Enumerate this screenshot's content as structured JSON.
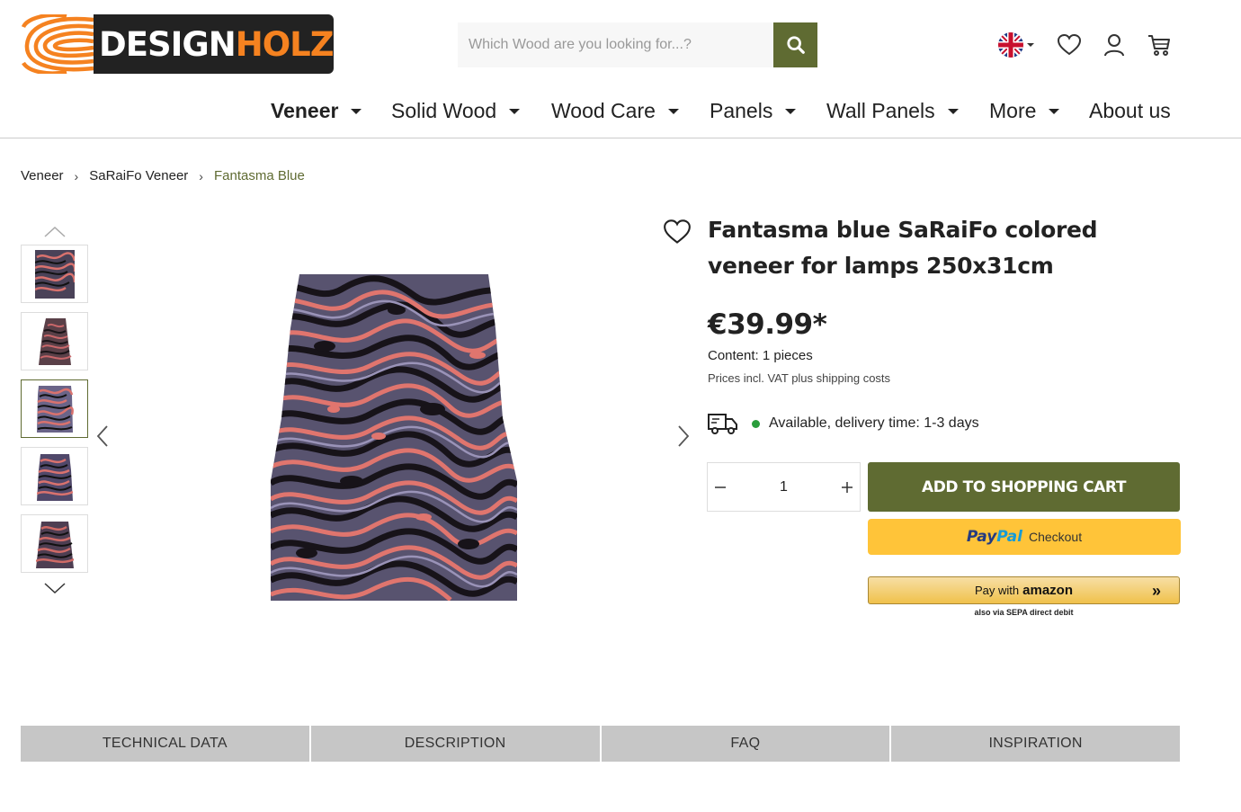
{
  "brand": {
    "part1": "DESIGN",
    "part2": "HOLZ",
    "accent": "#f58220"
  },
  "search": {
    "placeholder": "Which Wood are you looking for...?"
  },
  "header_icons": [
    "uk-flag-icon",
    "heart-icon",
    "user-icon",
    "cart-icon"
  ],
  "nav": {
    "items": [
      {
        "label": "Veneer",
        "dropdown": true,
        "active": true
      },
      {
        "label": "Solid Wood",
        "dropdown": true
      },
      {
        "label": "Wood Care",
        "dropdown": true
      },
      {
        "label": "Panels",
        "dropdown": true
      },
      {
        "label": "Wall Panels",
        "dropdown": true
      },
      {
        "label": "More",
        "dropdown": true
      },
      {
        "label": "About us",
        "dropdown": false
      }
    ]
  },
  "breadcrumb": [
    "Veneer",
    "SaRaiFo Veneer",
    "Fantasma Blue"
  ],
  "gallery": {
    "thumbnail_count": 5,
    "active_index": 2
  },
  "product": {
    "title_line1": "Fantasma blue SaRaiFo colored",
    "title_line2": "veneer for lamps 250x31cm",
    "price": "€39.99*",
    "content": "Content: 1 pieces",
    "vat_note": "Prices incl. VAT plus shipping costs",
    "availability": "Available, delivery time: 1-3 days",
    "quantity": "1",
    "add_to_cart": "ADD TO SHOPPING CART",
    "paypal_logo_1": "Pay",
    "paypal_logo_2": "Pal",
    "paypal_text": "Checkout",
    "amazon_text": "Pay with",
    "amazon_brand": "amazon",
    "amazon_sub": "also via SEPA direct debit"
  },
  "tabs": [
    "TECHNICAL DATA",
    "DESCRIPTION",
    "FAQ",
    "INSPIRATION"
  ],
  "colors": {
    "primary": "#5f6b32",
    "available": "#2a9d3c",
    "paypal": "#ffc439",
    "tab_bg": "#c6c6c6"
  }
}
